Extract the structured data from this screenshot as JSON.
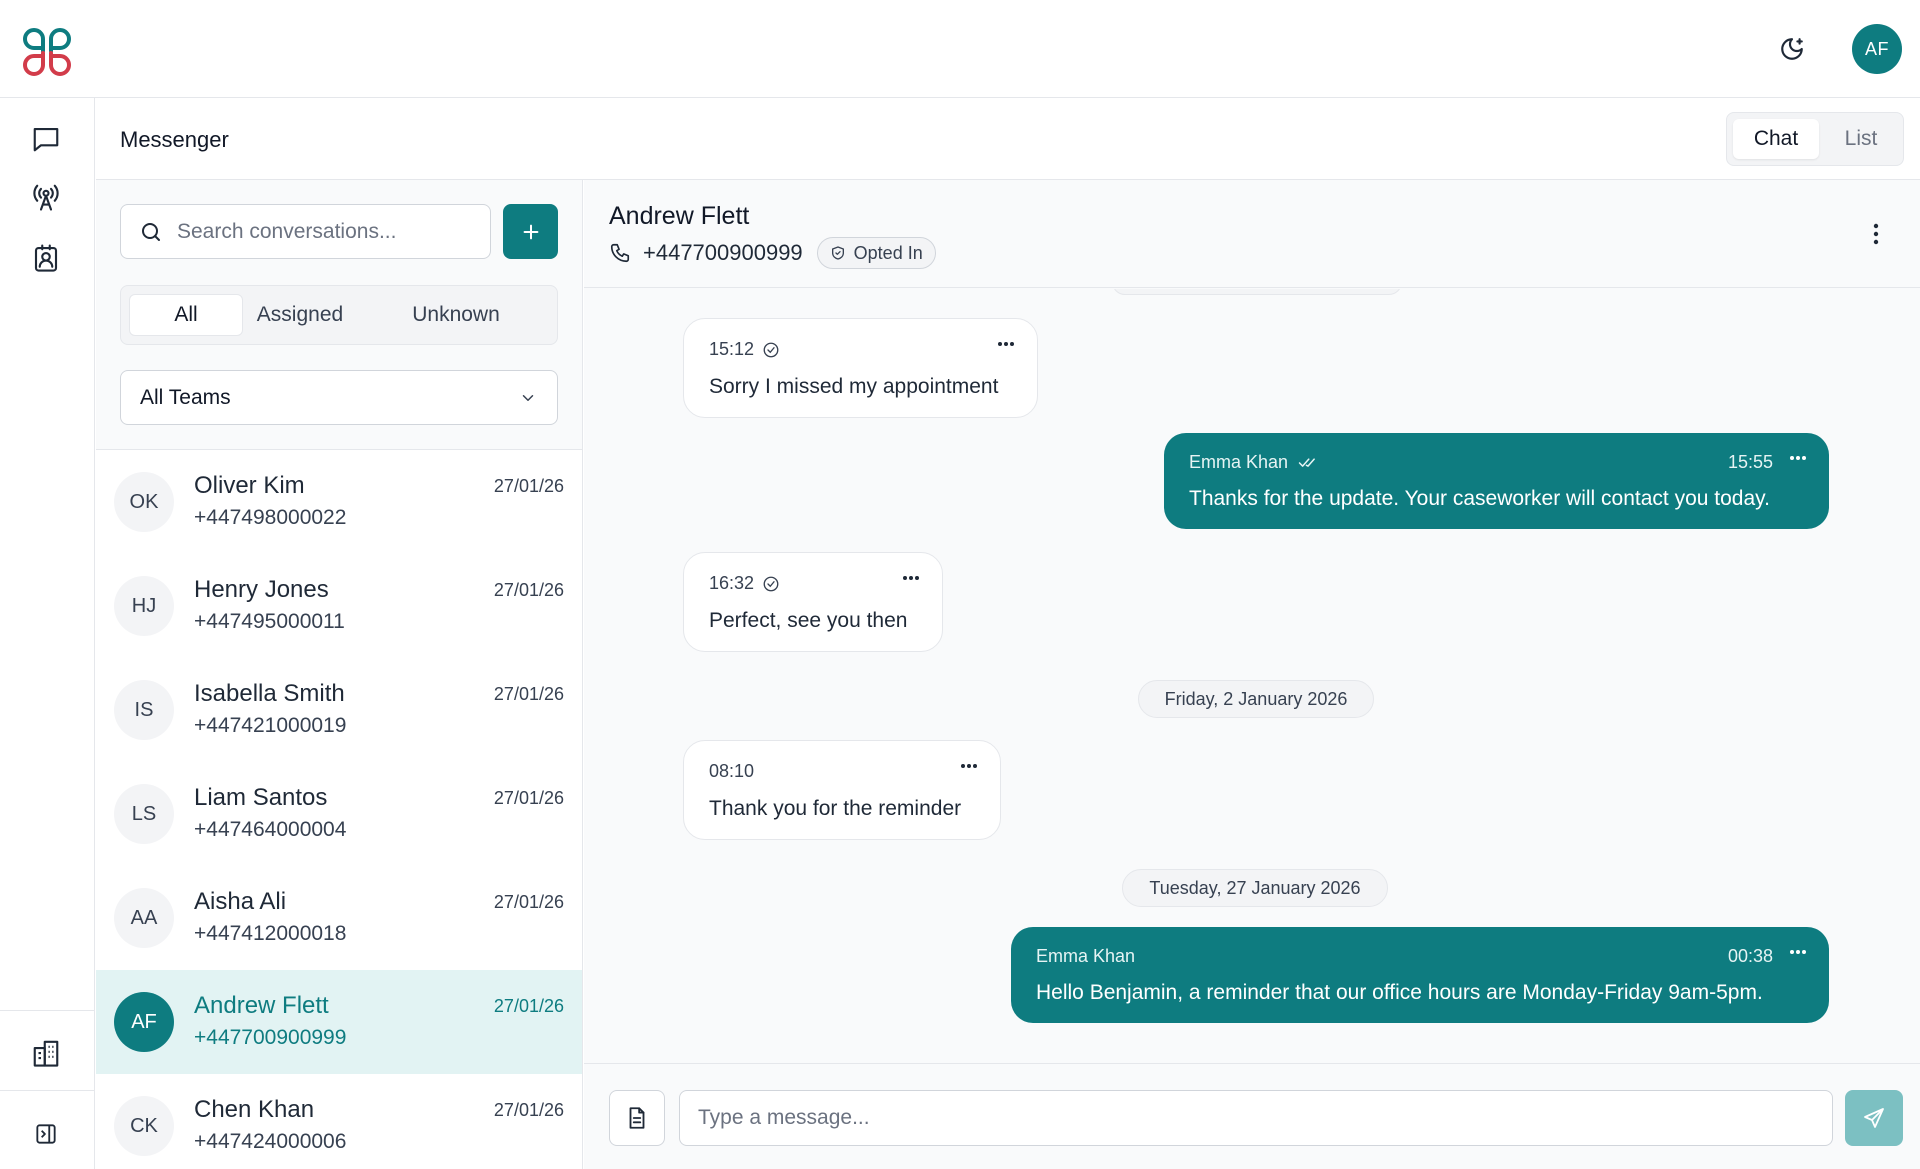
{
  "app": {
    "user_initials": "AF",
    "accent_color": "#0e7c80"
  },
  "header": {
    "title": "Messenger",
    "view_tabs": [
      "Chat",
      "List"
    ],
    "active_view": "Chat"
  },
  "sidebar": {
    "items": [
      {
        "icon": "chat-bubble-icon",
        "label": "Messages"
      },
      {
        "icon": "broadcast-antenna-icon",
        "label": "Broadcasts"
      },
      {
        "icon": "contact-badge-icon",
        "label": "Contacts"
      },
      {
        "icon": "building-icon",
        "label": "Organisation"
      },
      {
        "icon": "sidebar-expand-icon",
        "label": "Expand"
      }
    ]
  },
  "conversations_panel": {
    "search_placeholder": "Search conversations...",
    "filter_tabs": [
      "All",
      "Assigned",
      "Unknown"
    ],
    "active_filter": "All",
    "team_select": "All Teams",
    "items": [
      {
        "initials": "OK",
        "name": "Oliver Kim",
        "phone": "+447498000022",
        "date": "27/01/26"
      },
      {
        "initials": "HJ",
        "name": "Henry Jones",
        "phone": "+447495000011",
        "date": "27/01/26"
      },
      {
        "initials": "IS",
        "name": "Isabella Smith",
        "phone": "+447421000019",
        "date": "27/01/26"
      },
      {
        "initials": "LS",
        "name": "Liam Santos",
        "phone": "+447464000004",
        "date": "27/01/26"
      },
      {
        "initials": "AA",
        "name": "Aisha Ali",
        "phone": "+447412000018",
        "date": "27/01/26"
      },
      {
        "initials": "AF",
        "name": "Andrew Flett",
        "phone": "+447700900999",
        "date": "27/01/26",
        "selected": true
      },
      {
        "initials": "CK",
        "name": "Chen Khan",
        "phone": "+447424000006",
        "date": "27/01/26"
      }
    ]
  },
  "chat": {
    "contact_name": "Andrew Flett",
    "contact_phone": "+447700900999",
    "consent_badge": "Opted In",
    "messages": [
      {
        "direction": "in",
        "time": "15:12",
        "text": "Sorry I missed my appointment"
      },
      {
        "direction": "out",
        "sender": "Emma Khan",
        "time": "15:55",
        "text": "Thanks for the update. Your caseworker will contact you today."
      },
      {
        "direction": "in",
        "time": "16:32",
        "text": "Perfect, see you then"
      },
      {
        "direction": "separator",
        "text": "Friday, 2 January 2026"
      },
      {
        "direction": "in",
        "time": "08:10",
        "text": "Thank you for the reminder"
      },
      {
        "direction": "separator",
        "text": "Tuesday, 27 January 2026"
      },
      {
        "direction": "out",
        "sender": "Emma Khan",
        "time": "00:38",
        "text": "Hello Benjamin, a reminder that our office hours are Monday-Friday 9am-5pm."
      }
    ],
    "composer_placeholder": "Type a message..."
  }
}
